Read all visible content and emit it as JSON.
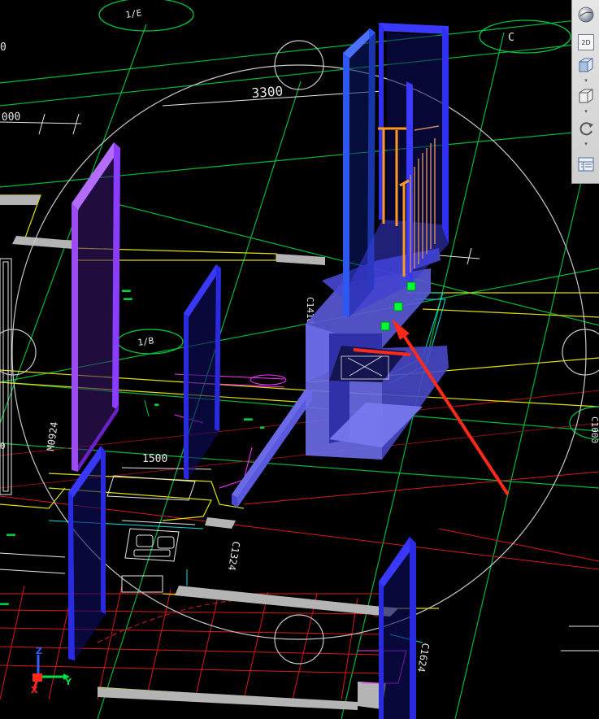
{
  "viewport": {
    "dimensions": {
      "d_top_3300": "3300",
      "d_top_left": "000",
      "d_top_left_0": "0",
      "d_mid_1500": "1500",
      "d_left_0": "0"
    },
    "wall_labels": {
      "c1418": "C1418",
      "c1624": "C1624",
      "m0924": "M0924",
      "c1324": "C1324",
      "c1000": "C1000"
    },
    "grid_bubbles": {
      "b1": "1/E",
      "b2": "C",
      "b3": "1/B"
    },
    "ucs": {
      "x_label": "X",
      "y_label": "Y",
      "z_label": "Z"
    }
  },
  "toolbar": {
    "buttons": [
      {
        "icon": "navigation-sphere-icon"
      },
      {
        "label": "2D",
        "icon": "2d-view-icon"
      },
      {
        "icon": "view-cube-icon"
      },
      {
        "icon": "box-view-icon"
      },
      {
        "icon": "orbit-rotate-icon"
      },
      {
        "icon": "view-manager-icon"
      }
    ]
  },
  "colors": {
    "background": "#000000",
    "axis_lines": "#00cc44",
    "walls_outline": "#e0e000",
    "wall_fill": "#bdbdbd",
    "solid_blue": "#2a2ae0",
    "solid_purple": "#8a3cff",
    "orbit_circle": "#c8c8c8",
    "arrow": "#ff2a1a",
    "grip": "#00ff33"
  }
}
